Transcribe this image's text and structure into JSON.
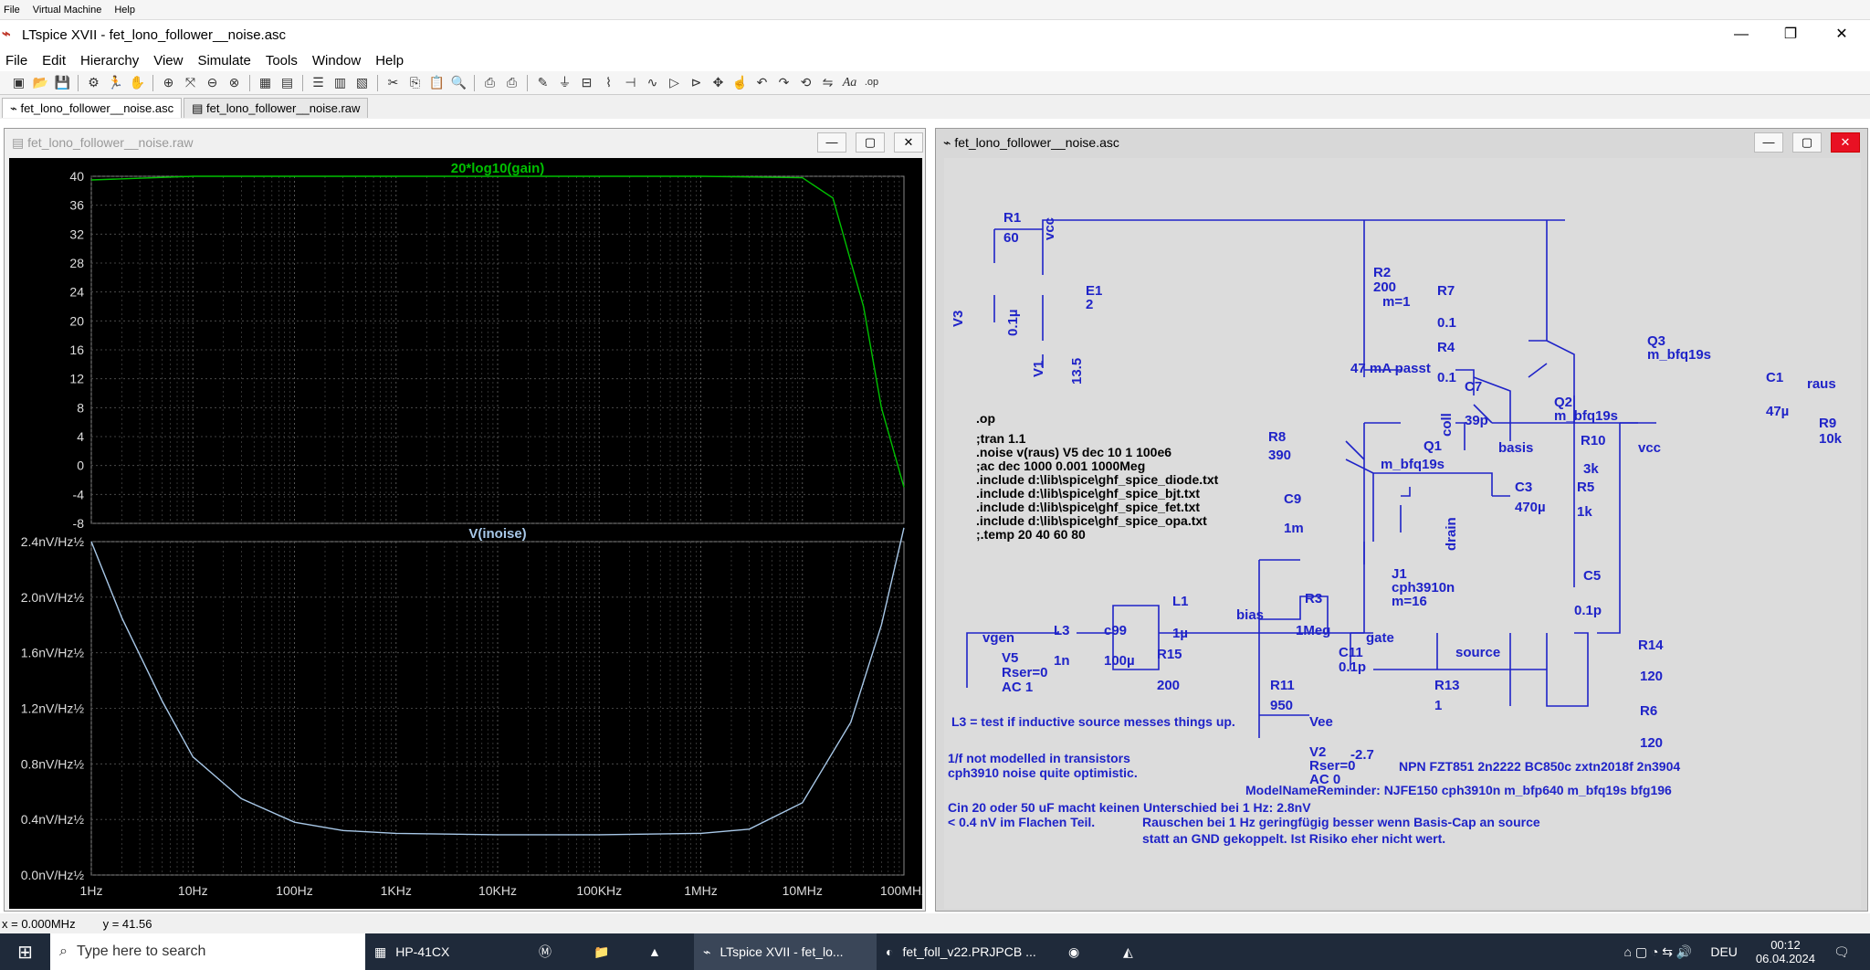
{
  "vm_menu": [
    "File",
    "Virtual Machine",
    "Help"
  ],
  "window": {
    "title": "LTspice XVII - fet_lono_follower__noise.asc"
  },
  "menu": [
    "File",
    "Edit",
    "Hierarchy",
    "View",
    "Simulate",
    "Tools",
    "Window",
    "Help"
  ],
  "tabs": [
    "fet_lono_follower__noise.asc",
    "fet_lono_follower__noise.raw"
  ],
  "wave_window": {
    "title": "fet_lono_follower__noise.raw"
  },
  "sch_window": {
    "title": "fet_lono_follower__noise.asc"
  },
  "colors": {
    "gain": "#00c000",
    "noise": "#a8c8e8",
    "schematic": "#1f23c8",
    "sch_bg": "#dcdcdc"
  },
  "chart_data": [
    {
      "type": "line",
      "title": "20*log10(gain)",
      "x_scale": "log",
      "xlim": [
        1,
        100000000
      ],
      "ylim": [
        -8,
        40
      ],
      "yticks": [
        "40",
        "36",
        "32",
        "28",
        "24",
        "20",
        "16",
        "12",
        "8",
        "4",
        "0",
        "-4",
        "-8"
      ],
      "series": [
        {
          "name": "20*log10(gain)",
          "x": [
            1,
            10,
            100,
            1000,
            10000,
            100000,
            1000000,
            10000000,
            20000000,
            40000000,
            60000000,
            100000000
          ],
          "y": [
            39.5,
            40,
            40,
            40,
            40,
            40,
            40,
            39.8,
            37,
            22,
            8,
            -3
          ]
        }
      ]
    },
    {
      "type": "line",
      "title": "V(inoise)",
      "x_scale": "log",
      "xlim": [
        1,
        100000000
      ],
      "ylim": [
        0,
        2.4
      ],
      "yticks": [
        "2.4nV/Hz½",
        "2.0nV/Hz½",
        "1.6nV/Hz½",
        "1.2nV/Hz½",
        "0.8nV/Hz½",
        "0.4nV/Hz½",
        "0.0nV/Hz½"
      ],
      "xticks": [
        "1Hz",
        "10Hz",
        "100Hz",
        "1KHz",
        "10KHz",
        "100KHz",
        "1MHz",
        "10MHz",
        "100MHz"
      ],
      "series": [
        {
          "name": "V(inoise)",
          "x": [
            1,
            2,
            5,
            10,
            30,
            100,
            300,
            1000,
            10000,
            100000,
            1000000,
            3000000,
            10000000,
            30000000,
            60000000,
            100000000
          ],
          "y": [
            2.4,
            1.85,
            1.25,
            0.85,
            0.55,
            0.38,
            0.32,
            0.3,
            0.29,
            0.29,
            0.3,
            0.33,
            0.52,
            1.1,
            1.8,
            2.5
          ]
        }
      ]
    }
  ],
  "schematic": {
    "labels": {
      "r1": "R1",
      "r1v": "60",
      "v3": "V3",
      "v3v": "0.1µ",
      "vcc1": "vcc",
      "e1": "E1",
      "e1v": "2",
      "v1": "V1",
      "v1v": "13.5",
      "r2": "R2",
      "r2v": "200",
      "r2m": "m=1",
      "r7": "R7",
      "r7v": "0.1",
      "r4": "R4",
      "r4v": "0.1",
      "q3": "Q3",
      "q3m": "m_bfq19s",
      "q2": "Q2",
      "q2m": "m_bfq19s",
      "passt": "47 mA passt",
      "c7": "C7",
      "c7v": "39p",
      "coll": "coll",
      "c1": "C1",
      "c1v": "47µ",
      "raus": "raus",
      "r9": "R9",
      "r9v": "10k",
      "q1": "Q1",
      "q1m": "m_bfq19s",
      "basis": "basis",
      "r10": "R10",
      "r10v": "3k",
      "vcc2": "vcc",
      "r5": "R5",
      "r5v": "1k",
      "c3": "C3",
      "c3v": "470µ",
      "drain": "drain",
      "r8": "R8",
      "r8v": "390",
      "c9": "C9",
      "c9v": "1m",
      "bias": "bias",
      "r3": "R3",
      "r3v": "1Meg",
      "j1": "J1",
      "j1m": "cph3910n",
      "j1mm": "m=16",
      "c5": "C5",
      "c5v": "0.1p",
      "vgen": "vgen",
      "l3": "L3",
      "l3v": "1n",
      "c99": "c99",
      "c99v": "100µ",
      "l1": "L1",
      "l1v": "1µ",
      "r15": "R15",
      "r15v": "200",
      "c11": "C11",
      "c11v": "0.1p",
      "gate": "gate",
      "source": "source",
      "r14": "R14",
      "r14v": "120",
      "r6": "R6",
      "r6v": "120",
      "v5": "V5",
      "v5r": "Rser=0",
      "v5a": "AC 1",
      "r11": "R11",
      "r11v": "950",
      "vee": "Vee",
      "r13": "R13",
      "r13v": "1",
      "v2": "V2",
      "v2v": "-2.7",
      "v2r": "Rser=0",
      "v2a": "AC 0"
    },
    "directives": [
      ".op",
      ";tran 1.1",
      ".noise v(raus) V5 dec 10 1 100e6",
      ";ac dec 1000 0.001 1000Meg",
      ".include d:\\lib\\spice\\ghf_spice_diode.txt",
      ".include d:\\lib\\spice\\ghf_spice_bjt.txt",
      ".include d:\\lib\\spice\\ghf_spice_fet.txt",
      ".include d:\\lib\\spice\\ghf_spice_opa.txt",
      ";.temp 20 40 60 80"
    ],
    "comments": {
      "l3note": "L3 = test if inductive source messes things up.",
      "n1a": "1/f not modelled in transistors",
      "n1b": "cph3910 noise quite optimistic.",
      "npn": "NPN FZT851  2n2222  BC850c  zxtn2018f  2n3904",
      "model": "ModelNameReminder:  NJFE150  cph3910n  m_bfp640  m_bfq19s bfg196",
      "cin": "Cin 20 oder 50 uF macht keinen Unterschied bei 1 Hz:  2.8nV",
      "flach": "< 0.4 nV im Flachen Teil.",
      "r1hz": "Rauschen bei 1 Hz geringfügig besser wenn Basis-Cap an source",
      "r1hz2": "statt  an GND gekoppelt.  Ist Risiko eher nicht wert."
    }
  },
  "status": {
    "x": "x = 0.000MHz",
    "y": "y = 41.56"
  },
  "taskbar": {
    "search_placeholder": "Type here to search",
    "apps": [
      "HP-41CX",
      "LTspice XVII - fet_lo...",
      "fet_foll_v22.PRJPCB ..."
    ],
    "lang": "DEU",
    "time": "00:12",
    "date": "06.04.2024"
  }
}
